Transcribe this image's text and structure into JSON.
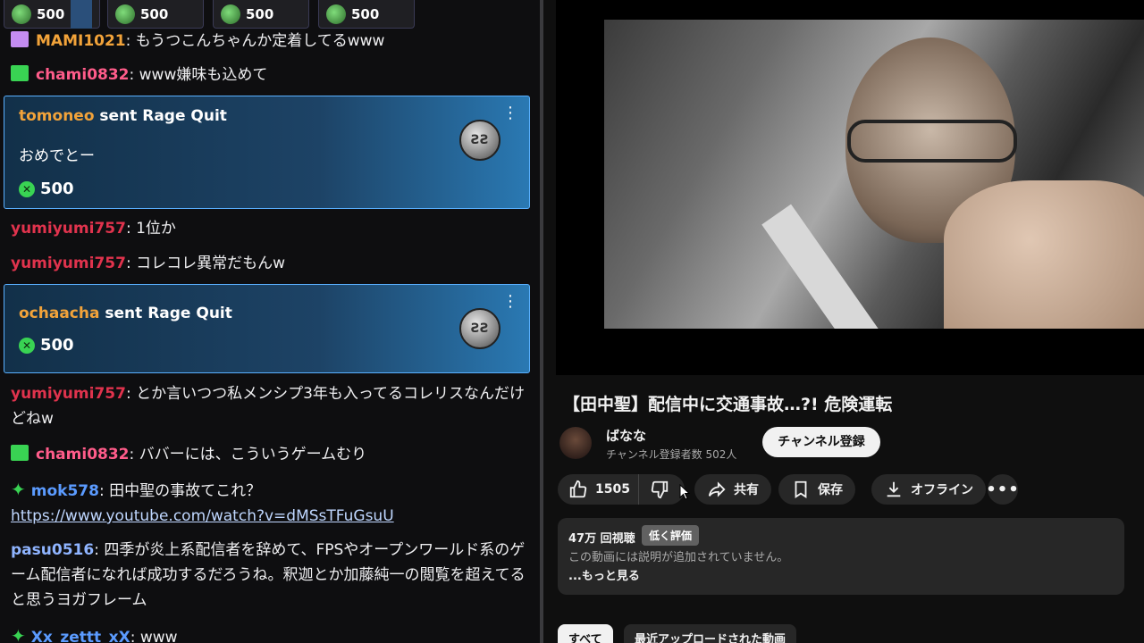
{
  "gift_bar": [
    {
      "amount": "500"
    },
    {
      "amount": "500"
    },
    {
      "amount": "500"
    },
    {
      "amount": "500"
    }
  ],
  "chat": {
    "msg1": {
      "user": "MAMI1021",
      "text": ": もうつこんちゃんか定着してるwww"
    },
    "msg2": {
      "user": "chami0832",
      "text": ": www嫌味も込めて"
    },
    "gift1": {
      "sender": "tomoneo",
      "sent": " sent ",
      "gift": "Rage Quit",
      "message": "おめでとー",
      "amount": "500"
    },
    "msg3": {
      "user": "yumiyumi757",
      "text": ": 1位か"
    },
    "msg4": {
      "user": "yumiyumi757",
      "text": ": コレコレ異常だもんw"
    },
    "gift2": {
      "sender": "ochaacha",
      "sent": " sent ",
      "gift": "Rage Quit",
      "amount": "500"
    },
    "msg5": {
      "user": "yumiyumi757",
      "text": ": とか言いつつ私メンシプ3年も入ってるコレリスなんだけどねw"
    },
    "msg6": {
      "user": "chami0832",
      "text": ": ババーには、こういうゲームむり"
    },
    "msg7": {
      "user": "mok578",
      "text": ": 田中聖の事故てこれ？",
      "link": "https://www.youtube.com/watch?v=dMSsTFuGsuU"
    },
    "msg8": {
      "user": "pasu0516",
      "text": ": 四季が炎上系配信者を辞めて、FPSやオープンワールド系のゲーム配信者になれば成功するだろうね。釈迦とか加藤純一の閲覧を超えてると思うヨガフレーム"
    },
    "msg9": {
      "user": "Xx_zettt_xX",
      "text": ": www"
    }
  },
  "video": {
    "title": "【田中聖】配信中に交通事故…?! 危険運転",
    "channel_name": "ばなな",
    "channel_subs": "チャンネル登録者数 502人",
    "subscribe_label": "チャンネル登録",
    "like_count": "1505",
    "share_label": "共有",
    "save_label": "保存",
    "offline_label": "オフライン",
    "views": "47万 回視聴",
    "tooltip": "低く評価",
    "description": "この動画には説明が追加されていません。",
    "more_label": "...もっと見る",
    "chip_all": "すべて",
    "chip_recent": "最近アップロードされた動画"
  },
  "colors": {
    "chat_bg": "#0e0e10",
    "gift_card_border": "#5ab0ff",
    "user_pink": "#ff5c8a",
    "user_red": "#e0334d",
    "user_blue": "#5b9bff",
    "user_gold": "#f2a33a",
    "user_lightblue": "#8fb4ff"
  },
  "icons": [
    "like-icon",
    "dislike-icon",
    "share-icon",
    "save-icon",
    "download-icon",
    "more-icon",
    "kebab-icon",
    "coin-icon",
    "gift-icon"
  ]
}
